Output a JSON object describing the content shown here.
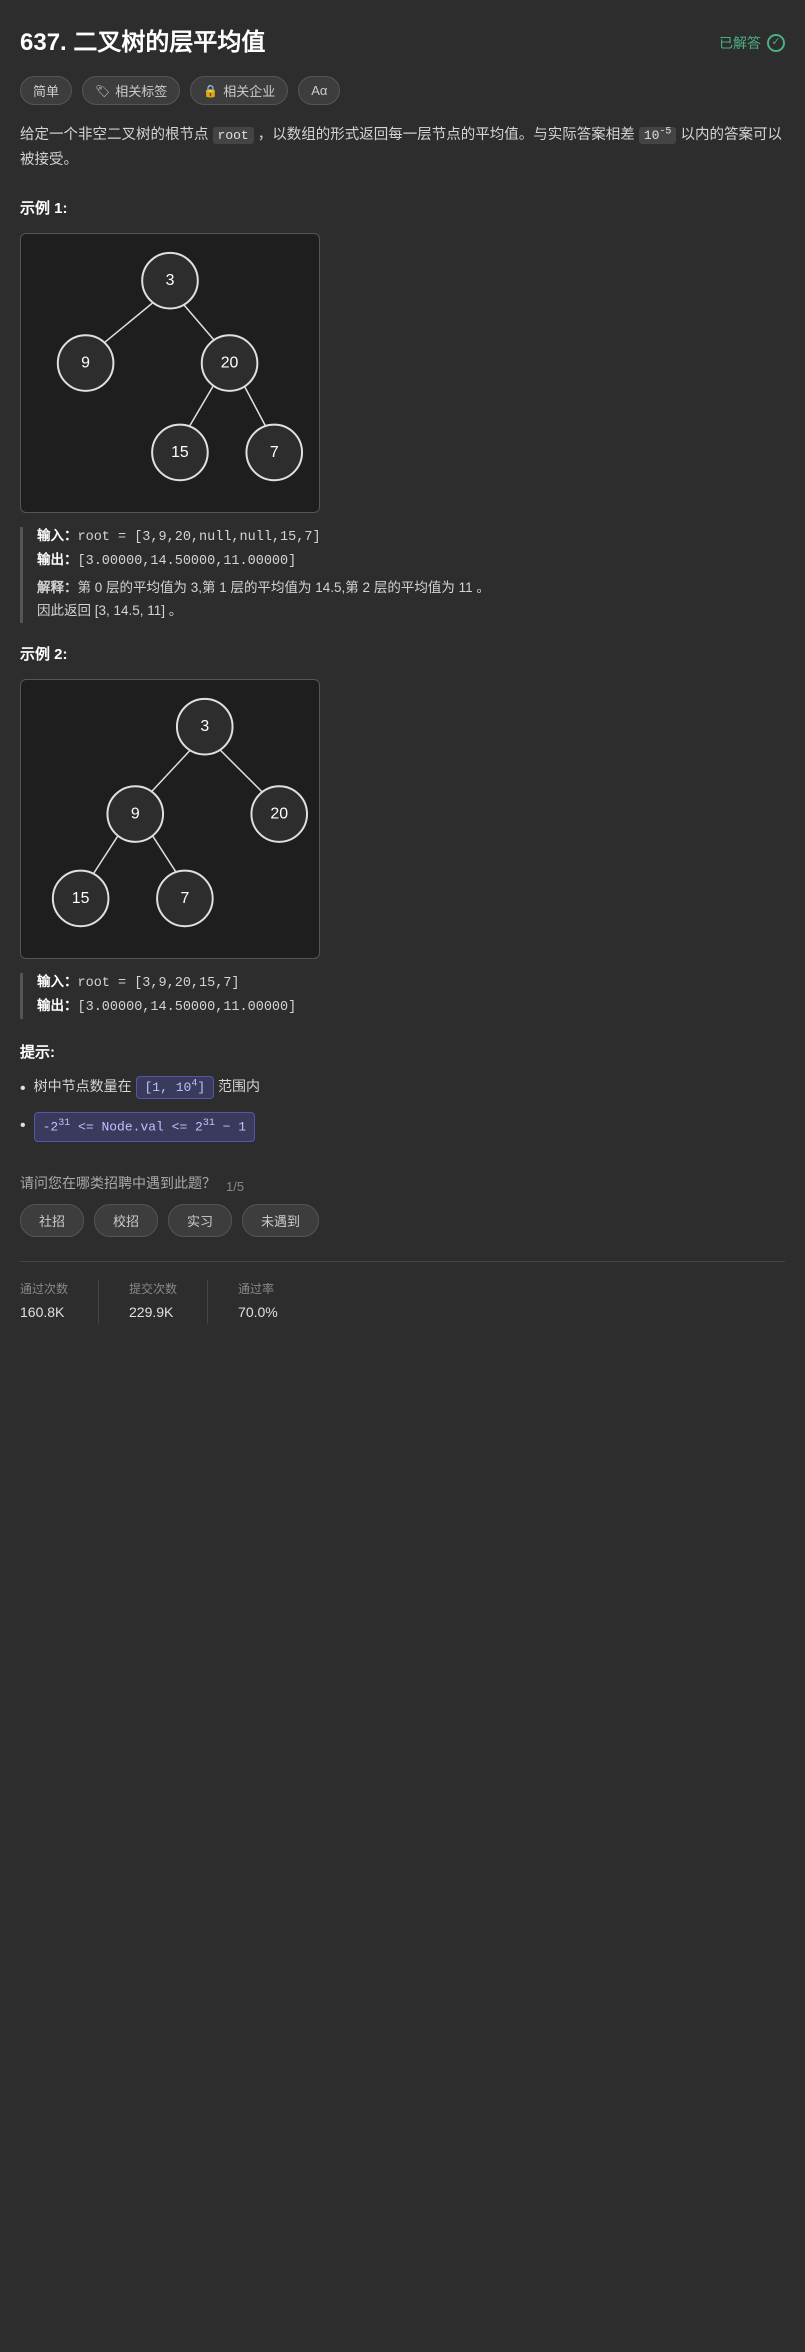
{
  "page": {
    "problem_number": "637.",
    "problem_title": "二叉树的层平均值",
    "solved_label": "已解答",
    "tags": [
      {
        "icon": "简",
        "label": "简单"
      },
      {
        "icon": "🏷",
        "label": "相关标签"
      },
      {
        "icon": "🔒",
        "label": "相关企业"
      },
      {
        "icon": "Aα",
        "label": "Aα"
      }
    ],
    "description": "给定一个非空二叉树的根节点 root ，以数组的形式返回每一层节点的平均值。与实际答案相差 10⁻⁵ 以内的答案可以被接受。",
    "example1_title": "示例 1:",
    "example1_input": "输入：root = [3,9,20,null,null,15,7]",
    "example1_output": "输出：[3.00000,14.50000,11.00000]",
    "example1_explanation_label": "解释：",
    "example1_explanation": "第 0 层的平均值为 3,第 1 层的平均值为 14.5,第 2 层的平均值为 11 。因此返回 [3, 14.5, 11] 。",
    "example2_title": "示例 2:",
    "example2_input": "输入：root = [3,9,20,15,7]",
    "example2_output": "输出：[3.00000,14.50000,11.00000]",
    "hints_title": "提示:",
    "hint1_text": "树中节点数量在 [1, 10⁴] 范围内",
    "hint2_code": "-2³¹ <= Node.val <= 2³¹ − 1",
    "survey_question": "请问您在哪类招聘中遇到此题？",
    "survey_progress": "1/5",
    "survey_options": [
      "社招",
      "校招",
      "实习",
      "未遇到"
    ],
    "stats": [
      {
        "label": "通过次数",
        "value": "160.8K"
      },
      {
        "label": "提交次数",
        "value": "229.9K"
      },
      {
        "label": "通过率",
        "value": "70.0%"
      }
    ]
  }
}
